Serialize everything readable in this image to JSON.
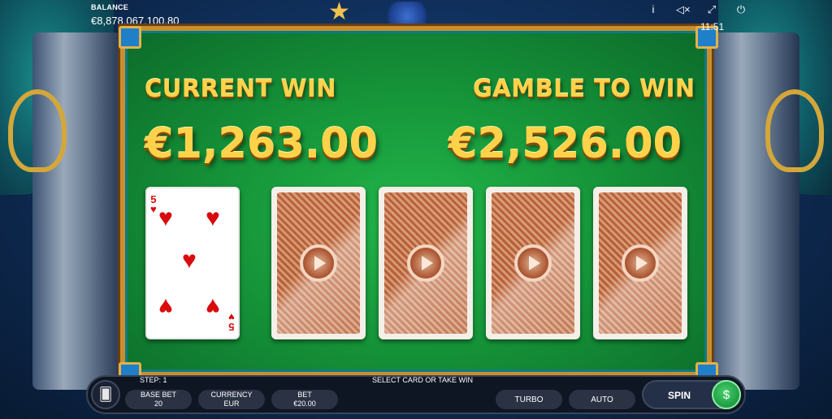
{
  "header": {
    "balance_label": "BALANCE",
    "balance_value": "€8,878,067,100.80",
    "clock": "11:51",
    "icons": [
      "info-icon",
      "sound-muted-icon",
      "fullscreen-icon",
      "power-icon"
    ]
  },
  "board": {
    "current_win_label": "CURRENT WIN",
    "current_win_value": "€1,263.00",
    "gamble_label": "GAMBLE TO WIN",
    "gamble_value": "€2,526.00",
    "dealer_card": {
      "rank": "5",
      "suit": "hearts",
      "suit_symbol": "♥"
    },
    "player_cards": [
      "face-down",
      "face-down",
      "face-down",
      "face-down"
    ]
  },
  "footer": {
    "step": "STEP: 1",
    "hint": "SELECT CARD OR TAKE WIN",
    "base_bet_label": "BASE BET",
    "base_bet_value": "20",
    "currency_label": "CURRENCY",
    "currency_value": "EUR",
    "bet_label": "BET",
    "bet_value": "€20.00",
    "turbo_label": "TURBO",
    "auto_label": "AUTO",
    "spin_label": "SPIN"
  },
  "colors": {
    "gold_text": "#ffd24a",
    "felt_green": "#159238",
    "frame_gold": "#c98f2e",
    "heart_red": "#d80c0c",
    "collect_green": "#1f9a43"
  }
}
